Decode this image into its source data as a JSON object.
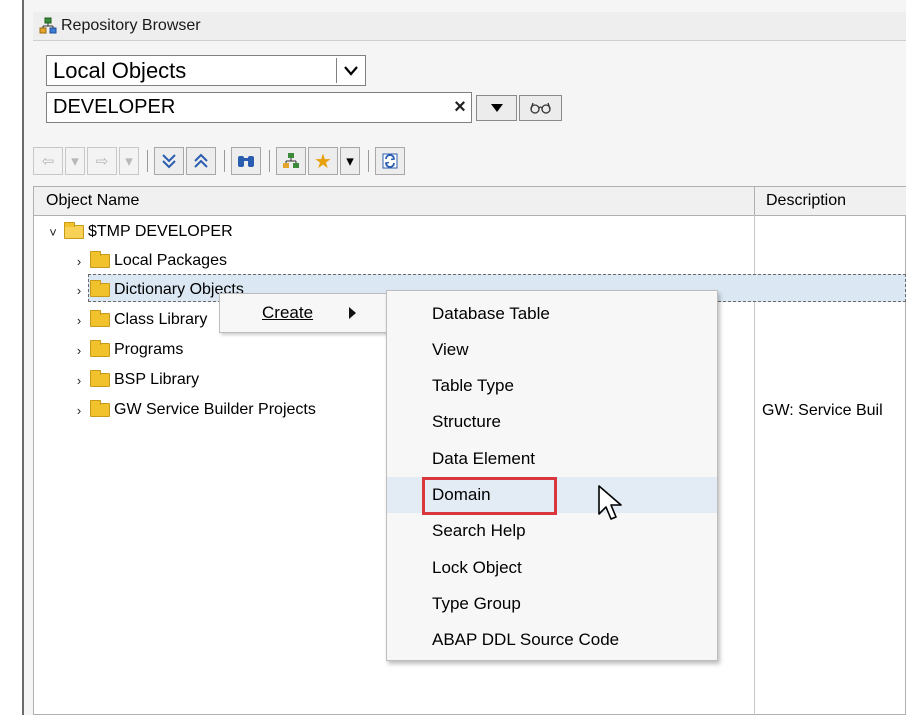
{
  "window": {
    "title": "Repository Browser"
  },
  "object_selector": {
    "value": "Local Objects",
    "dropdown_icon": "chevron-down-icon"
  },
  "user_field": {
    "value": "DEVELOPER",
    "clear_icon": "close-icon",
    "dropdown_icon": "triangle-down-icon",
    "glasses_icon": "glasses-icon"
  },
  "toolbar": {
    "buttons": [
      "back-arrow-icon",
      "forward-arrow-icon",
      "expand-all-icon",
      "collapse-all-icon",
      "find-icon",
      "hierarchy-icon",
      "favorites-icon",
      "refresh-icon"
    ]
  },
  "grid": {
    "columns": [
      "Object Name",
      "Description"
    ],
    "rows": [
      {
        "name": "$TMP DEVELOPER",
        "description": "",
        "expanded": true
      },
      {
        "name": "Local Packages",
        "description": ""
      },
      {
        "name": "Dictionary Objects",
        "description": ""
      },
      {
        "name": "Class Library",
        "description": ""
      },
      {
        "name": "Programs",
        "description": ""
      },
      {
        "name": "BSP Library",
        "description": ""
      },
      {
        "name": "GW Service Builder Projects",
        "description": "GW: Service Buil"
      }
    ],
    "selected_row": "Dictionary Objects"
  },
  "context_menu": {
    "create_label": "Create",
    "submenu_items": [
      "Database Table",
      "View",
      "Table Type",
      "Structure",
      "Data Element",
      "Domain",
      "Search Help",
      "Lock Object",
      "Type Group",
      "ABAP DDL Source Code"
    ],
    "hovered_item": "Domain"
  },
  "colors": {
    "highlight_box": "#d9363e",
    "selection_bg": "#dbe7f2",
    "folder": "#f2c22c"
  }
}
